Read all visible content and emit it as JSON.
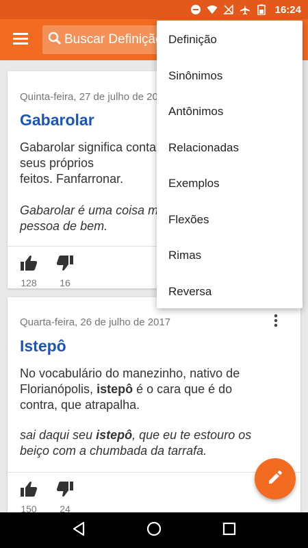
{
  "status_bar": {
    "time": "16:24"
  },
  "app_bar": {
    "search_placeholder": "Buscar Definição"
  },
  "cards": [
    {
      "date": "Quinta-feira, 27 de julho de 2017",
      "word": "Gabarolar",
      "definition_lines": [
        "Gabarolar significa contar vantagem dos",
        "seus próprios",
        "feitos. Fanfarronar."
      ],
      "example_lines": [
        "Gabarolar é uma coisa muito feia para uma",
        "pessoa de bem."
      ],
      "likes": "128",
      "dislikes": "16"
    },
    {
      "date": "Quarta-feira, 26 de julho de 2017",
      "word": "Istepô",
      "definition": {
        "line1": "No vocabulário do manezinho, nativo de",
        "line2_pre": "Florianópolis, ",
        "line2_bold": "istepô",
        "line2_post": " é o cara que é do",
        "line3": "contra, que atrapalha."
      },
      "example": {
        "line1_pre": "sai daqui seu ",
        "line1_bold": "istepô",
        "line1_post": ", que eu te estouro os",
        "line2": "beiço com a chumbada da tarrafa."
      },
      "likes": "150",
      "dislikes": "24"
    }
  ],
  "menu": {
    "items": [
      "Definição",
      "Sinônimos",
      "Antônimos",
      "Relacionadas",
      "Exemplos",
      "Flexões",
      "Rimas",
      "Reversa"
    ]
  },
  "colors": {
    "primary": "#f26b21",
    "status": "#e2591b",
    "word": "#1a55b8"
  }
}
